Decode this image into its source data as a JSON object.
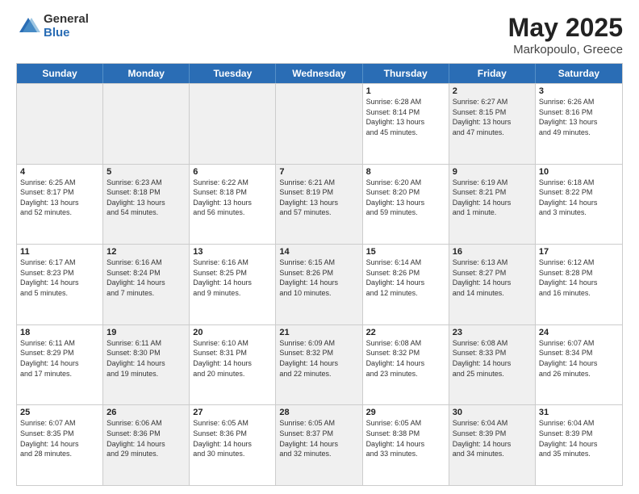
{
  "logo": {
    "general": "General",
    "blue": "Blue"
  },
  "title": {
    "month": "May 2025",
    "location": "Markopoulo, Greece"
  },
  "header_days": [
    "Sunday",
    "Monday",
    "Tuesday",
    "Wednesday",
    "Thursday",
    "Friday",
    "Saturday"
  ],
  "weeks": [
    [
      {
        "day": "",
        "info": "",
        "shaded": true
      },
      {
        "day": "",
        "info": "",
        "shaded": true
      },
      {
        "day": "",
        "info": "",
        "shaded": true
      },
      {
        "day": "",
        "info": "",
        "shaded": true
      },
      {
        "day": "1",
        "info": "Sunrise: 6:28 AM\nSunset: 8:14 PM\nDaylight: 13 hours\nand 45 minutes.",
        "shaded": false
      },
      {
        "day": "2",
        "info": "Sunrise: 6:27 AM\nSunset: 8:15 PM\nDaylight: 13 hours\nand 47 minutes.",
        "shaded": true
      },
      {
        "day": "3",
        "info": "Sunrise: 6:26 AM\nSunset: 8:16 PM\nDaylight: 13 hours\nand 49 minutes.",
        "shaded": false
      }
    ],
    [
      {
        "day": "4",
        "info": "Sunrise: 6:25 AM\nSunset: 8:17 PM\nDaylight: 13 hours\nand 52 minutes.",
        "shaded": false
      },
      {
        "day": "5",
        "info": "Sunrise: 6:23 AM\nSunset: 8:18 PM\nDaylight: 13 hours\nand 54 minutes.",
        "shaded": true
      },
      {
        "day": "6",
        "info": "Sunrise: 6:22 AM\nSunset: 8:18 PM\nDaylight: 13 hours\nand 56 minutes.",
        "shaded": false
      },
      {
        "day": "7",
        "info": "Sunrise: 6:21 AM\nSunset: 8:19 PM\nDaylight: 13 hours\nand 57 minutes.",
        "shaded": true
      },
      {
        "day": "8",
        "info": "Sunrise: 6:20 AM\nSunset: 8:20 PM\nDaylight: 13 hours\nand 59 minutes.",
        "shaded": false
      },
      {
        "day": "9",
        "info": "Sunrise: 6:19 AM\nSunset: 8:21 PM\nDaylight: 14 hours\nand 1 minute.",
        "shaded": true
      },
      {
        "day": "10",
        "info": "Sunrise: 6:18 AM\nSunset: 8:22 PM\nDaylight: 14 hours\nand 3 minutes.",
        "shaded": false
      }
    ],
    [
      {
        "day": "11",
        "info": "Sunrise: 6:17 AM\nSunset: 8:23 PM\nDaylight: 14 hours\nand 5 minutes.",
        "shaded": false
      },
      {
        "day": "12",
        "info": "Sunrise: 6:16 AM\nSunset: 8:24 PM\nDaylight: 14 hours\nand 7 minutes.",
        "shaded": true
      },
      {
        "day": "13",
        "info": "Sunrise: 6:16 AM\nSunset: 8:25 PM\nDaylight: 14 hours\nand 9 minutes.",
        "shaded": false
      },
      {
        "day": "14",
        "info": "Sunrise: 6:15 AM\nSunset: 8:26 PM\nDaylight: 14 hours\nand 10 minutes.",
        "shaded": true
      },
      {
        "day": "15",
        "info": "Sunrise: 6:14 AM\nSunset: 8:26 PM\nDaylight: 14 hours\nand 12 minutes.",
        "shaded": false
      },
      {
        "day": "16",
        "info": "Sunrise: 6:13 AM\nSunset: 8:27 PM\nDaylight: 14 hours\nand 14 minutes.",
        "shaded": true
      },
      {
        "day": "17",
        "info": "Sunrise: 6:12 AM\nSunset: 8:28 PM\nDaylight: 14 hours\nand 16 minutes.",
        "shaded": false
      }
    ],
    [
      {
        "day": "18",
        "info": "Sunrise: 6:11 AM\nSunset: 8:29 PM\nDaylight: 14 hours\nand 17 minutes.",
        "shaded": false
      },
      {
        "day": "19",
        "info": "Sunrise: 6:11 AM\nSunset: 8:30 PM\nDaylight: 14 hours\nand 19 minutes.",
        "shaded": true
      },
      {
        "day": "20",
        "info": "Sunrise: 6:10 AM\nSunset: 8:31 PM\nDaylight: 14 hours\nand 20 minutes.",
        "shaded": false
      },
      {
        "day": "21",
        "info": "Sunrise: 6:09 AM\nSunset: 8:32 PM\nDaylight: 14 hours\nand 22 minutes.",
        "shaded": true
      },
      {
        "day": "22",
        "info": "Sunrise: 6:08 AM\nSunset: 8:32 PM\nDaylight: 14 hours\nand 23 minutes.",
        "shaded": false
      },
      {
        "day": "23",
        "info": "Sunrise: 6:08 AM\nSunset: 8:33 PM\nDaylight: 14 hours\nand 25 minutes.",
        "shaded": true
      },
      {
        "day": "24",
        "info": "Sunrise: 6:07 AM\nSunset: 8:34 PM\nDaylight: 14 hours\nand 26 minutes.",
        "shaded": false
      }
    ],
    [
      {
        "day": "25",
        "info": "Sunrise: 6:07 AM\nSunset: 8:35 PM\nDaylight: 14 hours\nand 28 minutes.",
        "shaded": false
      },
      {
        "day": "26",
        "info": "Sunrise: 6:06 AM\nSunset: 8:36 PM\nDaylight: 14 hours\nand 29 minutes.",
        "shaded": true
      },
      {
        "day": "27",
        "info": "Sunrise: 6:05 AM\nSunset: 8:36 PM\nDaylight: 14 hours\nand 30 minutes.",
        "shaded": false
      },
      {
        "day": "28",
        "info": "Sunrise: 6:05 AM\nSunset: 8:37 PM\nDaylight: 14 hours\nand 32 minutes.",
        "shaded": true
      },
      {
        "day": "29",
        "info": "Sunrise: 6:05 AM\nSunset: 8:38 PM\nDaylight: 14 hours\nand 33 minutes.",
        "shaded": false
      },
      {
        "day": "30",
        "info": "Sunrise: 6:04 AM\nSunset: 8:39 PM\nDaylight: 14 hours\nand 34 minutes.",
        "shaded": true
      },
      {
        "day": "31",
        "info": "Sunrise: 6:04 AM\nSunset: 8:39 PM\nDaylight: 14 hours\nand 35 minutes.",
        "shaded": false
      }
    ]
  ]
}
